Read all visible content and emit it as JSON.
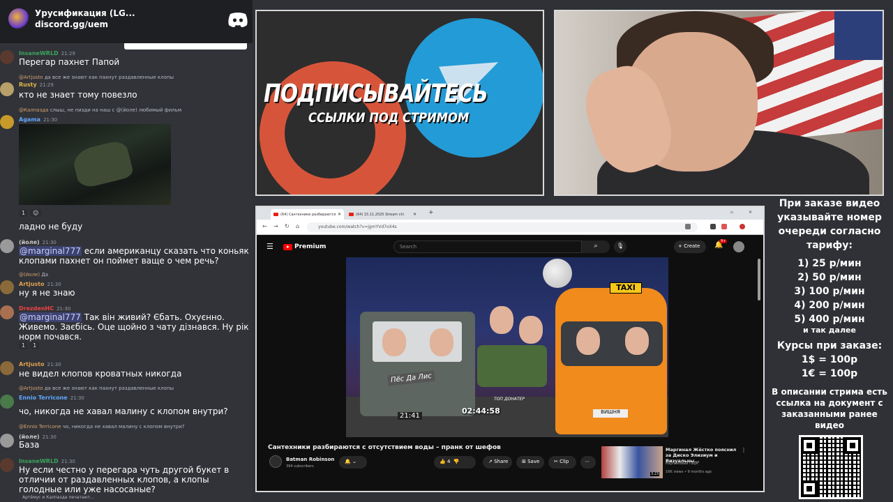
{
  "discord_widget": {
    "server_name": "Урусификация (LG...",
    "invite_link": "discord.gg/uem"
  },
  "messages": [
    {
      "user": "InsaneWRLD",
      "user_color": "#3ba55d",
      "time": "21:29",
      "text": "Перегар пахнет Папой"
    },
    {
      "reply_user": "@Artjusto",
      "reply_text": "да все же знают как пахнут раздавленные клопы",
      "user": "Rusty",
      "user_color": "#e0b94a",
      "time": "21:29",
      "text": "кто не знает тому повезло"
    },
    {
      "reply_user": "@Калпазда",
      "reply_text": "слыш, не пизди на наш с @(йоле) любимый фильм",
      "user": "Agama",
      "user_color": "#5fa7ff",
      "time": "21:30",
      "reactions": [
        "1",
        "☺"
      ]
    },
    {
      "text": "ладно не буду"
    },
    {
      "user": "(йоле)",
      "user_color": "#c9c9c9",
      "time": "21:30",
      "mention": "@marginal777",
      "text": "если американцу сказать что коньяк клопами пахнет он поймет ваще о чем речь?"
    },
    {
      "reply_user": "@(йоле)",
      "reply_text": "Да",
      "user": "Artjusto",
      "user_color": "#e0a050",
      "time": "21:30",
      "text": "ну я не знаю"
    },
    {
      "user": "DrezdenHC",
      "user_color": "#ed4245",
      "time": "21:30",
      "mention": "@marginal777",
      "text": "Так він живий? Єбать. Охуєнно. Живемо. Заєбісь. Оце щойно з чату дізнався. Ну рік норм почався.",
      "reactions": [
        "1",
        "1"
      ]
    },
    {
      "user": "Artjusto",
      "user_color": "#e0a050",
      "time": "21:30",
      "text": "не видел клопов кроватных никогда"
    },
    {
      "reply_user": "@Artjusto",
      "reply_text": "да все же знают как пахнут раздавленные клопы",
      "user": "Ennio Terricone",
      "user_color": "#5fa7ff",
      "time": "21:30",
      "text": "чо, никогда не хавал малину с клопом внутри?"
    },
    {
      "reply_user": "@Ennio Terricone",
      "reply_text": "чо, никогда не хавал малину с клопом внутри?",
      "user": "(йоле)",
      "user_color": "#c9c9c9",
      "time": "21:30",
      "text": "База"
    },
    {
      "user": "InsaneWRLD",
      "user_color": "#3ba55d",
      "time": "21:30",
      "text": "Ну если честно у перегара чуть другой букет в отличии от раздавленных клопов, а клопы голодные или уже насосаные?"
    }
  ],
  "typing_indicator": "Артёмус и Калпазда печатают...",
  "promo": {
    "line1": "ПОДПИСЫВАЙТЕСЬ",
    "line2": "ССЫЛКИ ПОД СТРИМОМ"
  },
  "browser": {
    "tabs": [
      {
        "label": "(64) Сантехники разбираются",
        "active": true
      },
      {
        "label": "(64) 15.11.2025 Stream chi",
        "active": false
      }
    ],
    "url": "youtube.com/watch?v=jgmYVd7oX4s",
    "youtube": {
      "brand": "Premium",
      "search_placeholder": "Search",
      "create_label": "Create",
      "notification_count": "9+",
      "video": {
        "title": "Сантехники разбираются с отсутствием воды – пранк от шефов",
        "overlay_timer": "02:44:58",
        "clock": "21:41",
        "truck_sign": "Пёс Да Лис",
        "taxi_sign": "TAXI",
        "taxi_plate": "ВИШНЯ",
        "top_donor_label": "ТОП ДОНАТЕР"
      },
      "channel": {
        "name": "Batman Robinson",
        "subscribers": "394 subscribers"
      },
      "actions": {
        "likes": "4",
        "share": "Share",
        "save": "Save",
        "clip": "Clip"
      },
      "recommendation": {
        "title": "Маргинал Жёстко пояснил за Диско Элизиум и Визуальны...",
        "channel": "Карликовый Паук",
        "meta": "16K views • 9 months ago",
        "duration": "3:23"
      }
    }
  },
  "price_panel": {
    "heading": "При заказе видео указывайте номер очереди согласно тарифу:",
    "tariffs": [
      "1) 25 р/мин",
      "2) 50 р/мин",
      "3) 100 р/мин",
      "4) 200 р/мин",
      "5) 400 р/мин"
    ],
    "more": "и так далее",
    "courses_title": "Курсы при заказе:",
    "rates": [
      "1$ = 100р",
      "1€ = 100р"
    ],
    "note": "В описании стрима есть ссылка на документ с заказанными ранее видео"
  }
}
